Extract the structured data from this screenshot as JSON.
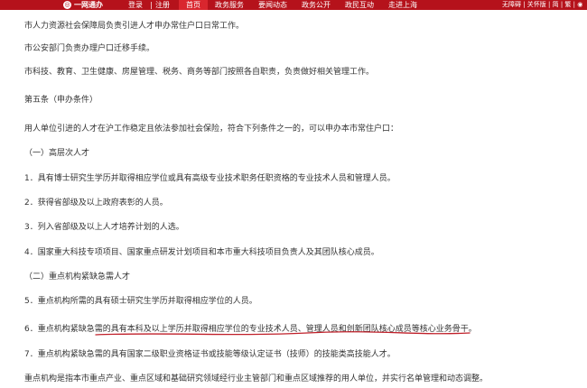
{
  "header": {
    "logo_text": "一网通办",
    "login_label": "登录",
    "separator": "|",
    "register_label": "注册",
    "nav_items": [
      {
        "label": "首页",
        "active": true
      },
      {
        "label": "政务服务",
        "active": false
      },
      {
        "label": "要闻动态",
        "active": false
      },
      {
        "label": "政务公开",
        "active": false
      },
      {
        "label": "政民互动",
        "active": false
      },
      {
        "label": "走进上海",
        "active": false
      }
    ],
    "tools_text": "无障碍 | 关怀版 | 简 | 繁 | ◉",
    "accent_color": "#b5121b"
  },
  "article": {
    "lines": [
      "市人力资源社会保障局负责引进人才申办常住户口日常工作。",
      "市公安部门负责办理户口迁移手续。",
      "市科技、教育、卫生健康、房屋管理、税务、商务等部门按照各自职责，负责做好相关管理工作。",
      "第五条（申办条件）",
      "用人单位引进的人才在沪工作稳定且依法参加社会保险，符合下列条件之一的，可以申办本市常住户口：",
      "（一）高层次人才",
      "1．具有博士研究生学历并取得相应学位或具有高级专业技术职务任职资格的专业技术人员和管理人员。",
      "2．获得省部级及以上政府表彰的人员。",
      "3．列入省部级及以上人才培养计划的人选。",
      "4．国家重大科技专项项目、国家重点研发计划项目和本市重大科技项目负责人及其团队核心成员。",
      "（二）重点机构紧缺急需人才",
      "5．重点机构所需的具有硕士研究生学历并取得相应学位的人员。",
      "6．重点机构紧缺急需的具有本科及以上学历并取得相应学位的专业技术人员、管理人员和创新团队核心成员等核心业务骨干。",
      "7．重点机构紧缺急需的具有国家二级职业资格证书或技能等级认定证书（技师）的技能类高技能人才。",
      "重点机构是指本市重点产业、重点区域和基础研究领域经行业主管部门和重点区域推荐的用人单位，并实行名单管理和动态调整。"
    ],
    "annotation_color": "#c0202a"
  }
}
